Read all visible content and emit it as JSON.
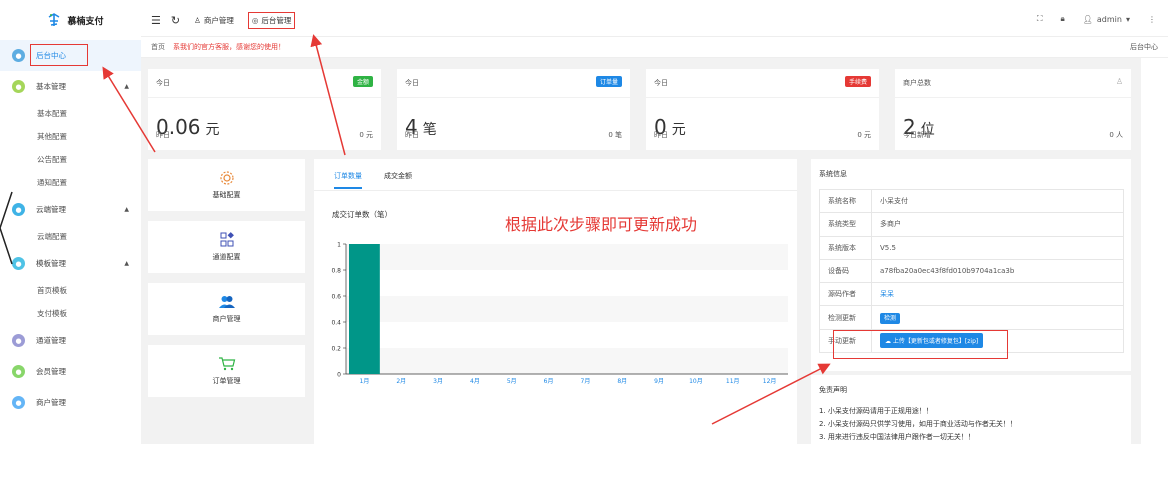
{
  "sidebar": {
    "logo_text": "慕楠支付",
    "items": [
      {
        "label": "后台中心",
        "color": "#5dade2"
      },
      {
        "label": "基本管理",
        "color": "#a5d65a",
        "subs": [
          "基本配置",
          "其他配置",
          "公告配置",
          "通知配置"
        ]
      },
      {
        "label": "云端管理",
        "color": "#3fb3e6",
        "subs": [
          "云端配置"
        ]
      },
      {
        "label": "模板管理",
        "color": "#4fc3e6",
        "subs": [
          "首页模板",
          "支付模板"
        ]
      },
      {
        "label": "通道管理",
        "color": "#9c9cd6"
      },
      {
        "label": "会员管理",
        "color": "#88d66a"
      },
      {
        "label": "商户管理",
        "color": "#64b5f6"
      }
    ]
  },
  "topbar": {
    "merchant_label": "商户管理",
    "backend_label": "后台管理",
    "user": "admin"
  },
  "breadcrumb": {
    "home": "首页",
    "notice": "系我们的官方客服，感谢您的使用！",
    "right": "后台中心"
  },
  "stats": [
    {
      "title": "今日",
      "badge": "金额",
      "badge_color": "#2fb344",
      "value": "0.06",
      "unit": "元",
      "foot_label": "昨日",
      "foot_value": "0 元"
    },
    {
      "title": "今日",
      "badge": "订单量",
      "badge_color": "#1e88e5",
      "value": "4",
      "unit": "笔",
      "foot_label": "昨日",
      "foot_value": "0 笔"
    },
    {
      "title": "今日",
      "badge": "手续费",
      "badge_color": "#e53935",
      "value": "0",
      "unit": "元",
      "foot_label": "昨日",
      "foot_value": "0 元"
    },
    {
      "title": "商户总数",
      "badge": "",
      "badge_color": "",
      "value": "2",
      "unit": "位",
      "foot_label": "今日新增",
      "foot_value": "0 人"
    }
  ],
  "quick_links": [
    {
      "label": "基础配置",
      "icon": "gear-icon"
    },
    {
      "label": "通道配置",
      "icon": "grid-icon"
    },
    {
      "label": "商户管理",
      "icon": "users-icon"
    },
    {
      "label": "订单管理",
      "icon": "cart-icon"
    }
  ],
  "tabs": [
    "订单数量",
    "成交金额"
  ],
  "overlay_text": "根据此次步骤即可更新成功",
  "chart_data": {
    "type": "bar",
    "title": "成交订单数（笔）",
    "categories": [
      "1月",
      "2月",
      "3月",
      "4月",
      "5月",
      "6月",
      "7月",
      "8月",
      "9月",
      "10月",
      "11月",
      "12月"
    ],
    "values": [
      1,
      0,
      0,
      0,
      0,
      0,
      0,
      0,
      0,
      0,
      0,
      0
    ],
    "ylim": [
      0,
      1
    ],
    "yticks": [
      "0",
      "0.2",
      "0.4",
      "0.6",
      "0.8",
      "1"
    ],
    "bar_color": "#009688",
    "grid": true
  },
  "system_info": {
    "title": "系统信息",
    "rows": [
      {
        "key": "系统名称",
        "value": "小呆支付"
      },
      {
        "key": "系统类型",
        "value": "多商户"
      },
      {
        "key": "系统版本",
        "value": "V5.5"
      },
      {
        "key": "设备码",
        "value": "a78fba20a0ec43f8fd010b9704a1ca3b"
      },
      {
        "key": "源码作者",
        "value": "呆呆"
      },
      {
        "key": "检测更新",
        "value": "检测"
      },
      {
        "key": "手动更新",
        "value": "上传【更新包或者修复包】[zip]"
      }
    ]
  },
  "disclaimer": {
    "title": "免责声明",
    "lines": [
      "1. 小呆支付源码请用于正规用途！！",
      "2. 小呆支付源码只供学习使用，如用于商业活动与作者无关！！",
      "3. 用来进行违反中国法律用户跟作者一切无关！！"
    ]
  }
}
